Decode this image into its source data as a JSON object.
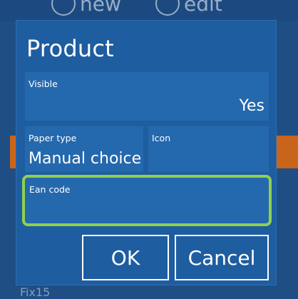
{
  "background": {
    "actions": [
      {
        "label": "new",
        "icon": "plus-circle-icon"
      },
      {
        "label": "edit",
        "icon": "pencil-circle-icon"
      }
    ],
    "partial_text": "Fix15"
  },
  "dialog": {
    "title": "Product",
    "fields": {
      "visible": {
        "label": "Visible",
        "value": "Yes"
      },
      "paper_type": {
        "label": "Paper type",
        "value": "Manual choice"
      },
      "icon": {
        "label": "Icon",
        "value": ""
      },
      "ean_code": {
        "label": "Ean code",
        "value": ""
      }
    },
    "buttons": {
      "ok": "OK",
      "cancel": "Cancel"
    }
  },
  "colors": {
    "dialog_bg": "#1e5da0",
    "field_bg": "#2468ad",
    "highlight": "#8fd14f",
    "accent_orange": "#c9651b"
  }
}
